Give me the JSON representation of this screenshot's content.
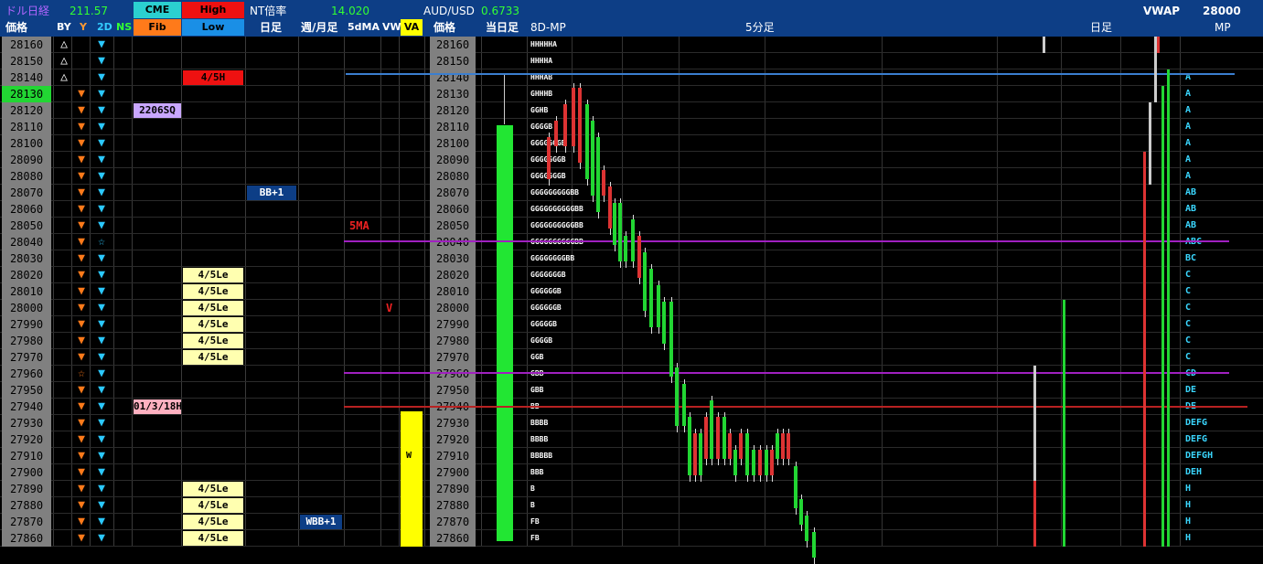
{
  "header": {
    "nikkei_label": "ドル日経",
    "nikkei_value": "211.57",
    "cme_label": "CME",
    "high_label": "High",
    "nt_label": "NT倍率",
    "nt_value": "14.020",
    "aud_label": "AUD/USD",
    "aud_value": "0.6733",
    "vwap_label": "VWAP",
    "vwap_value": "28000",
    "top_right_text": "28000"
  },
  "columns": {
    "price": "価格",
    "by": "BY",
    "y": "Y",
    "d2": "2D",
    "ns": "NS",
    "fib": "Fib",
    "low": "Low",
    "daily": "日足",
    "weekly": "週/月足",
    "ma5": "5dMA",
    "vw": "VW",
    "va": "VA",
    "daily_bar": "当日足",
    "mp8d": "8D-MP",
    "min5": "5分足",
    "daily2": "日足",
    "mp": "MP"
  },
  "colors": {
    "accent_green": "#22d633",
    "yellow": "#ffff00",
    "red": "#ee1111",
    "purple": "#a020c0",
    "blue": "#3b7fd0"
  },
  "rows": [
    {
      "price": "28160",
      "by": "up-open",
      "mp8d": "HHHHHA",
      "mp": ""
    },
    {
      "price": "28150",
      "by": "up-open",
      "mp8d": "HHHHA",
      "mp": ""
    },
    {
      "price": "28140",
      "by": "up-open",
      "mp8d": "HHHAB",
      "mp": "A"
    },
    {
      "price": "28130",
      "by": "down",
      "mp8d": "GHHHB",
      "mp": "A",
      "hl": true
    },
    {
      "price": "28120",
      "by": "down",
      "mp8d": "GGHB",
      "mp": "A"
    },
    {
      "price": "28110",
      "by": "down",
      "mp8d": "GGGGB",
      "mp": "A"
    },
    {
      "price": "28100",
      "by": "down",
      "mp8d": "GGGGGGGB",
      "mp": "A"
    },
    {
      "price": "28090",
      "by": "down",
      "mp8d": "GGGGGGGB",
      "mp": "A"
    },
    {
      "price": "28080",
      "by": "down",
      "mp8d": "GGGGGGGB",
      "mp": "A"
    },
    {
      "price": "28070",
      "by": "down",
      "mp8d": "GGGGGGGGGBB",
      "mp": "AB"
    },
    {
      "price": "28060",
      "by": "down",
      "mp8d": "GGGGGGGGGGBB",
      "mp": "AB"
    },
    {
      "price": "28050",
      "by": "down",
      "mp8d": "GGGGGGGGGGBB",
      "mp": "AB"
    },
    {
      "price": "28040",
      "by": "down",
      "mp8d": "GGGGGGGGGGBB",
      "mp": "ABC"
    },
    {
      "price": "28030",
      "by": "down",
      "mp8d": "GGGGGGGGBB",
      "mp": "BC"
    },
    {
      "price": "28020",
      "by": "down",
      "mp8d": "GGGGGGGB",
      "mp": "C"
    },
    {
      "price": "28010",
      "by": "down",
      "mp8d": "GGGGGGB",
      "mp": "C"
    },
    {
      "price": "28000",
      "by": "down",
      "mp8d": "GGGGGGB",
      "mp": "C"
    },
    {
      "price": "27990",
      "by": "down",
      "mp8d": "GGGGGB",
      "mp": "C"
    },
    {
      "price": "27980",
      "by": "down",
      "mp8d": "GGGGB",
      "mp": "C"
    },
    {
      "price": "27970",
      "by": "down",
      "mp8d": "GGB",
      "mp": "C"
    },
    {
      "price": "27960",
      "by": "star",
      "mp8d": "GBB",
      "mp": "CD"
    },
    {
      "price": "27950",
      "by": "down",
      "mp8d": "GBB",
      "mp": "DE"
    },
    {
      "price": "27940",
      "by": "down",
      "mp8d": "BB",
      "mp": "DE"
    },
    {
      "price": "27930",
      "by": "down",
      "mp8d": "BBBB",
      "mp": "DEFG"
    },
    {
      "price": "27920",
      "by": "down",
      "mp8d": "BBBB",
      "mp": "DEFG"
    },
    {
      "price": "27910",
      "by": "down",
      "mp8d": "BBBBB",
      "mp": "DEFGH"
    },
    {
      "price": "27900",
      "by": "down",
      "mp8d": "BBB",
      "mp": "DEH"
    },
    {
      "price": "27890",
      "by": "down",
      "mp8d": "B",
      "mp": "H"
    },
    {
      "price": "27880",
      "by": "down",
      "mp8d": "B",
      "mp": "H"
    },
    {
      "price": "27870",
      "by": "down",
      "mp8d": "FB",
      "mp": "H"
    },
    {
      "price": "27860",
      "by": "down",
      "mp8d": "FB",
      "mp": "H"
    }
  ],
  "tags": {
    "fib_2206sq": "2206SQ",
    "fib_date": "01/3/18H",
    "high_45h": "4/5H",
    "low_45le": "4/5Le",
    "daily_bb": "BB+1",
    "weekly_bb": "WBB+1",
    "ma_5ma": "5MA",
    "vw_v": "V",
    "va_w": "W"
  }
}
